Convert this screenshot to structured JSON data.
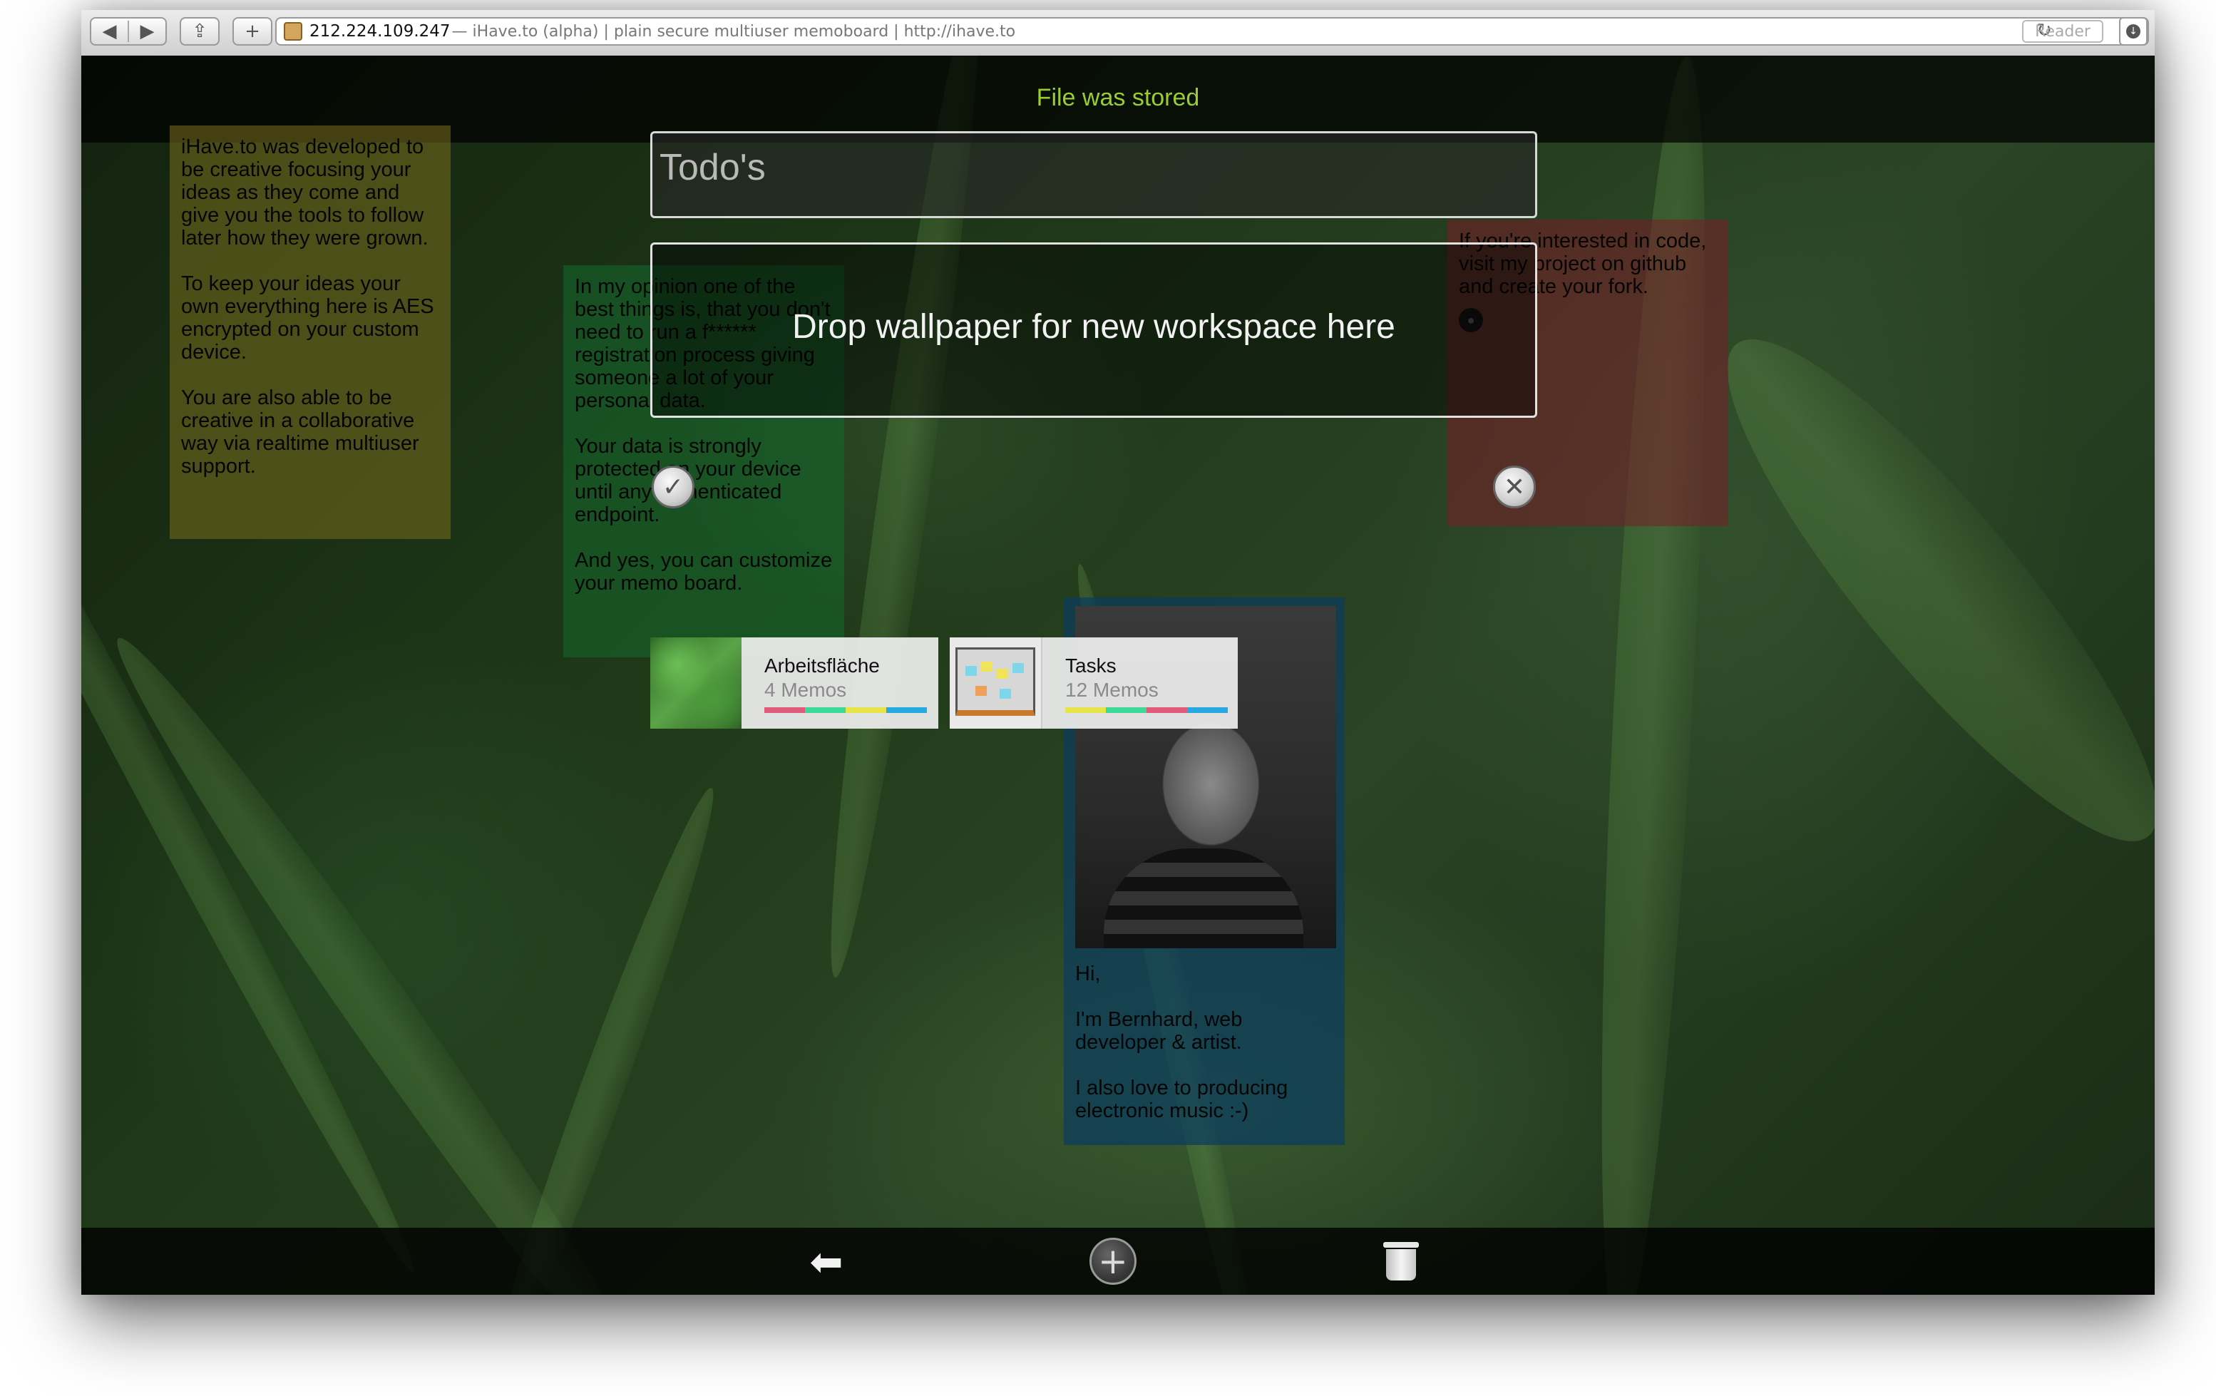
{
  "browser": {
    "url_host": "212.224.109.247",
    "url_rest": " — iHave.to (alpha) | plain secure multiuser memoboard | http://ihave.to",
    "reader_label": "Reader"
  },
  "status": "File was stored",
  "title_input": {
    "value": "Todo's"
  },
  "dropzone_text": "Drop wallpaper for new workspace here",
  "memos": {
    "yellow": {
      "p1": "iHave.to was developed to be creative focusing your ideas as they come and give you the tools to follow later how they were grown.",
      "p2": "To keep your ideas your own everything here is AES encrypted on your custom device.",
      "p3": "You are also able to be creative in a collaborative way via realtime multiuser support."
    },
    "green": {
      "p1": "In my opinion one of the best things is, that you don't need to run a f****** registration process giving someone a lot of your personal data.",
      "p2": "Your data is strongly protected on your device until any authenticated endpoint.",
      "p3": "And yes, you can customize your memo board."
    },
    "red": {
      "p1": "If you're interested in code, visit my project on github and create your fork."
    },
    "blue": {
      "p1": "Hi,",
      "p2": "I'm Bernhard, web developer & artist.",
      "p3": "I also love to producing electronic music :-)"
    }
  },
  "workspaces": [
    {
      "name": "Arbeitsfläche",
      "count": "4 Memos",
      "bar_colors": [
        "#e05a7a",
        "#3bd89a",
        "#e7e44a",
        "#27a8e0"
      ]
    },
    {
      "name": "Tasks",
      "count": "12 Memos",
      "bar_colors": [
        "#e7e44a",
        "#3bd89a",
        "#e05a7a",
        "#27a8e0"
      ]
    }
  ],
  "colors": {
    "status": "#9acd32",
    "memo_yellow": "#786e1e",
    "memo_green": "#14692d",
    "memo_red": "#781e28",
    "memo_blue": "#0a3c5f"
  },
  "icons": {
    "confirm": "check-icon",
    "cancel": "close-icon",
    "back": "back-arrow-icon",
    "add": "plus-icon",
    "delete": "trash-icon",
    "github": "github-icon"
  }
}
